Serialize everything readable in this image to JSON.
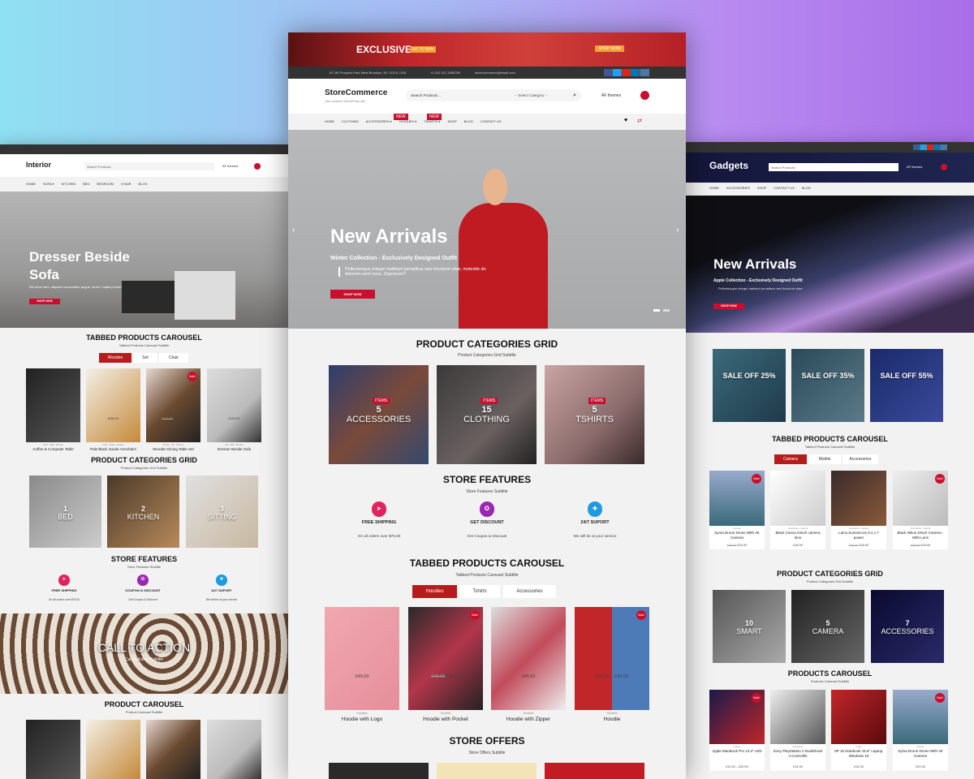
{
  "colors": {
    "accent": "#c8102e",
    "topbar": "#333333",
    "gadgets_header": "#14163a"
  },
  "center": {
    "promo": {
      "text": "EXCLUSIVE",
      "tag": "UP TO 50%",
      "cta": "SHOP NOW"
    },
    "topbar": {
      "address": "107 80 Prospect Park West Brooklyn, NY 11215, USA",
      "phone": "+1 012 012 3456789",
      "email": "storecommerce@email.com"
    },
    "logo": "StoreCommerce",
    "tagline": "Just another WordPress site",
    "search": {
      "placeholder": "Search Products...",
      "category": "-- Select Category --"
    },
    "account": "AF themes",
    "nav": [
      "HOME",
      "CLOTHING",
      "ACCESSORIES ▾",
      "HOODIES ▾",
      "TSHIRTS ▾",
      "SHOP",
      "BLOG",
      "CONTACT US"
    ],
    "nav_badge": "NEW",
    "hero": {
      "title": "New Arrivals",
      "subtitle": "Winter Collection - Exclusively Designed Outfit",
      "text": "Pellentesque integer habitant penatibus wisi tincidunt vitae, molestie do dolorem sent nunc. Dignissim?",
      "button": "SHOP NOW"
    },
    "categories": {
      "title": "PRODUCT CATEGORIES GRID",
      "subtitle": "Product Categories Grid Subtitle",
      "items": [
        {
          "count": "5",
          "name": "ACCESSORIES",
          "badge": "ITEMS"
        },
        {
          "count": "15",
          "name": "CLOTHING",
          "badge": "ITEMS"
        },
        {
          "count": "5",
          "name": "TSHIRTS",
          "badge": "ITEMS"
        }
      ]
    },
    "features": {
      "title": "STORE FEATURES",
      "subtitle": "Store Features Subtitle",
      "items": [
        {
          "label": "FREE SHIPPING",
          "desc": "On all orders over $75.00",
          "color": "#e0245e"
        },
        {
          "label": "GET DISCOUNT",
          "desc": "Get Coupon & Discount",
          "color": "#9c27b0"
        },
        {
          "label": "24/7 SUPORT",
          "desc": "We will be at your service",
          "color": "#1e9be0"
        }
      ]
    },
    "tabbed": {
      "title": "TABBED PRODUCTS CAROUSEL",
      "subtitle": "Tabbed Products Carousel Subtitle",
      "tabs": [
        "Hoodies",
        "Tshirts",
        "Accessories"
      ],
      "products": [
        {
          "cat": "Hoodies",
          "name": "Hoodie with Logo",
          "price": "£45.00",
          "old": "",
          "sale": false
        },
        {
          "cat": "Hoodies",
          "name": "Hoodie with Pocket",
          "price": "£35.00",
          "old": "£45.00",
          "sale": true
        },
        {
          "cat": "Hoodies",
          "name": "Hoodie with Zipper",
          "price": "£45.00",
          "old": "",
          "sale": false
        },
        {
          "cat": "Hoodies",
          "name": "Hoodie",
          "price": "£42.00 – £45.00",
          "old": "",
          "sale": true
        }
      ]
    },
    "offers": {
      "title": "STORE OFFERS",
      "subtitle": "Store Offers Subtitle"
    },
    "sale_label": "Sale!"
  },
  "left": {
    "logo": "Interior",
    "tagline": "Just another WordPress site",
    "search": "Search Products",
    "category": "-- Select Category --",
    "account": "AF themes",
    "nav": [
      "HOME",
      "SOFA ▾",
      "KITCHEN",
      "BED",
      "BEDROOM",
      "CHAIR",
      "BLOG"
    ],
    "hero": {
      "title": "Dresser Beside Sofa",
      "text": "Elit tortor sem, aliquam consectetur augue, lorem, mattis primis?",
      "button": "SHOP NOW"
    },
    "tabbed": {
      "title": "TABBED PRODUCTS CAROUSEL",
      "subtitle": "Tabbed Products Carousel Subtitle",
      "tabs": [
        "Wooden",
        "Set",
        "Chair"
      ],
      "products": [
        {
          "cat": "Chair · Table · Wooden",
          "name": "Coffee & Computer Table",
          "price": "£230.00"
        },
        {
          "cat": "Chair · Single · Wooden",
          "name": "Pale Black Suede Armchairs",
          "price": "£250.00"
        },
        {
          "cat": "Kitchen · Set · Wooden",
          "name": "Wooden Dining Table Set",
          "price": "£130.00",
          "old": "£150.00"
        },
        {
          "cat": "Set · Sofa · Wooden",
          "name": "Dresser Beside Sofa",
          "price": "£130.00"
        }
      ]
    },
    "categories": {
      "title": "PRODUCT CATEGORIES GRID",
      "subtitle": "Product Categories Grid Subtitle",
      "items": [
        {
          "count": "1",
          "name": "BED"
        },
        {
          "count": "2",
          "name": "KITCHEN"
        },
        {
          "count": "3",
          "name": "SITTING"
        }
      ]
    },
    "features": {
      "title": "STORE FEATURES",
      "subtitle": "Store Features Subtitle",
      "items": [
        {
          "label": "FREE SHIPPING",
          "desc": "On all orders over $75.00"
        },
        {
          "label": "COUPON & DISCOUNT",
          "desc": "Get Coupon & Discount"
        },
        {
          "label": "24/7 SUPORT",
          "desc": "We will be at your service"
        }
      ]
    },
    "cta": {
      "title": "CALL TO ACTION",
      "subtitle": "Call to Action Subtitle"
    },
    "carousel": {
      "title": "PRODUCT CAROUSEL",
      "subtitle": "Product Carousel Subtitle"
    }
  },
  "right": {
    "logo": "Gadgets",
    "tagline": "Just another WordPress site",
    "search": "Search Products",
    "category": "-- Select Category --",
    "account": "AF themes",
    "nav": [
      "HOME",
      "ACCESSORIES",
      "SHOP",
      "CONTACT US",
      "BLOG"
    ],
    "hero": {
      "title": "New Arrivals",
      "subtitle": "Apple Collection - Exclusively Designed Outfit",
      "text": "Pellentesque integer habitant penatibus wisi tincidunt vitae.",
      "button": "SHOP NOW"
    },
    "sales": [
      "SALE OFF 25%",
      "SALE OFF 35%",
      "SALE OFF 55%"
    ],
    "tabbed": {
      "title": "TABBED PRODUCTS CAROUSEL",
      "subtitle": "Tabbed Products Carousel Subtitle",
      "tabs": [
        "Camera",
        "Mobile",
        "Accessories"
      ],
      "products": [
        {
          "cat": "Camera",
          "name": "Syma Drone Drone With 4K Camera",
          "price": "£22.00",
          "old": "£30.00"
        },
        {
          "cat": "Accessories · Camera",
          "name": "Black Canon DSLR camera lens",
          "price": "£18.00"
        },
        {
          "cat": "Accessories · Camera",
          "name": "Leica Summicron 8.4 x 7 power",
          "price": "£18.00",
          "old": "£30.00"
        },
        {
          "cat": "Accessories · Camera",
          "name": "Black Nikon DSLR Camera - With Lens",
          "price": "£18.00",
          "old": "£30.00"
        }
      ]
    },
    "categories": {
      "title": "PRODUCT CATEGORIES GRID",
      "subtitle": "Product Categories Grid Subtitle",
      "items": [
        {
          "count": "10",
          "name": "SMART"
        },
        {
          "count": "5",
          "name": "CAMERA"
        },
        {
          "count": "7",
          "name": "ACCESSORIES"
        }
      ]
    },
    "carousel": {
      "title": "PRODUCTS CAROUSEL",
      "subtitle": "Products Carousel Subtitle",
      "products": [
        {
          "cat": "Laptop",
          "name": "Apple MacBook Pro 13.3\" LED",
          "price": "£14.00 – £40.00"
        },
        {
          "cat": "Accessories",
          "name": "Sony PlayStation 4 DualShock 4 Controller",
          "price": "£14.00"
        },
        {
          "cat": "Laptop",
          "name": "HP 15 Notebook 15.6\" Laptop, Windows 10",
          "price": "£14.00"
        },
        {
          "cat": "Camera",
          "name": "Syma Drone Drone With 4K Camera",
          "price": "£22.00"
        }
      ]
    }
  }
}
